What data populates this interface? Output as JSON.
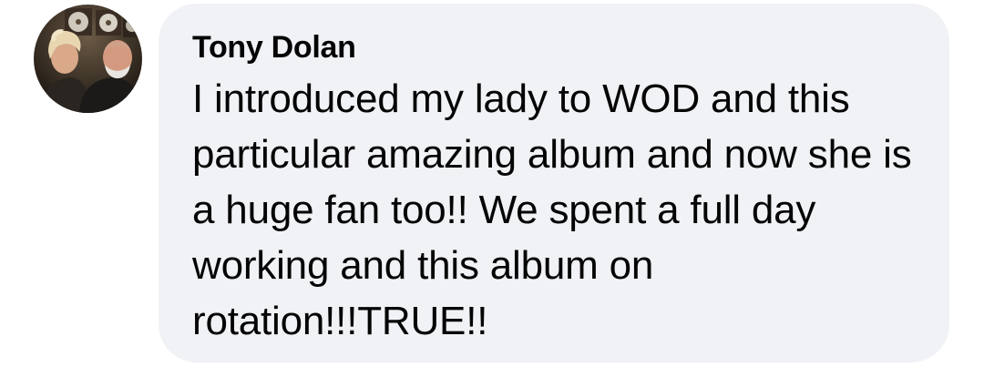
{
  "comment": {
    "author": "Tony Dolan",
    "text": "I introduced my lady to WOD and this particular amazing album and now she is a huge fan too!! We spent a full day working and this album on rotation!!!TRUE!!",
    "avatar_icon": "profile-photo-couple"
  },
  "colors": {
    "bubble_background": "#f0f2f5",
    "text": "#050505",
    "page_background": "#ffffff"
  }
}
